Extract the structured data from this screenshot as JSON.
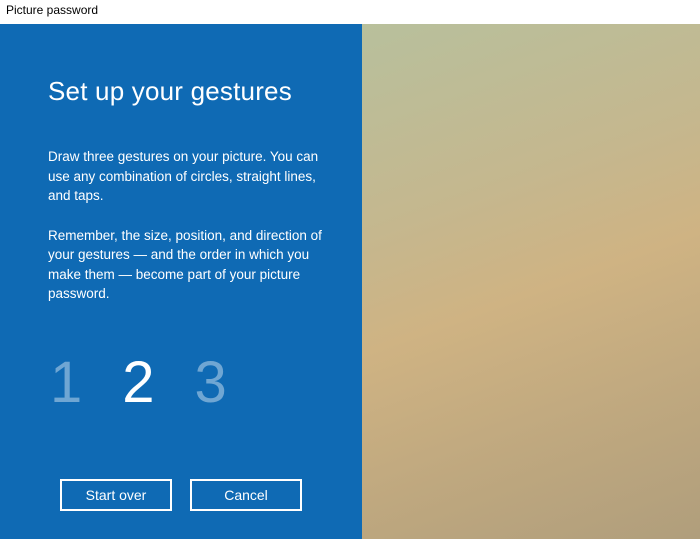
{
  "window": {
    "title": "Picture password"
  },
  "panel": {
    "heading": "Set up your gestures",
    "instructions": [
      "Draw three gestures on your picture. You can use any combination of circles, straight lines, and taps.",
      "Remember, the size, position, and direction of your gestures — and the order in which you make them — become part of your picture password."
    ],
    "steps": [
      "1",
      "2",
      "3"
    ],
    "active_step_index": 1,
    "buttons": {
      "start_over": "Start over",
      "cancel": "Cancel"
    }
  },
  "colors": {
    "panel_bg": "#0f6ab4",
    "step_inactive": "#6fa6d3",
    "step_active": "#ffffff"
  }
}
